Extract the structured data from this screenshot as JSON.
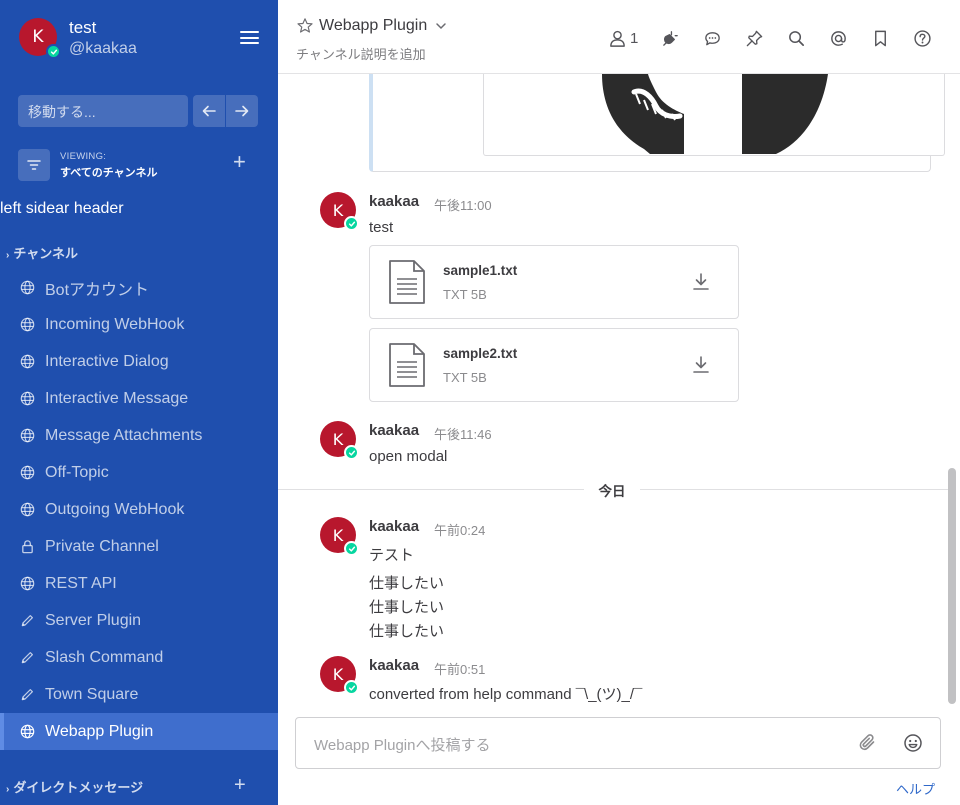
{
  "team": {
    "name": "test",
    "username": "@kaakaa",
    "avatar_letter": "K"
  },
  "jump": {
    "placeholder": "移動する..."
  },
  "viewing": {
    "label": "VIEWING:",
    "value": "すべてのチャンネル"
  },
  "sidebar_header": "left sidear header",
  "channels_category": "チャンネル",
  "channels": [
    {
      "name": "Botアカウント",
      "icon": "globe-icon"
    },
    {
      "name": "Incoming WebHook",
      "icon": "globe-icon"
    },
    {
      "name": "Interactive Dialog",
      "icon": "globe-icon"
    },
    {
      "name": "Interactive Message",
      "icon": "globe-icon"
    },
    {
      "name": "Message Attachments",
      "icon": "globe-icon"
    },
    {
      "name": "Off-Topic",
      "icon": "globe-icon"
    },
    {
      "name": "Outgoing WebHook",
      "icon": "globe-icon"
    },
    {
      "name": "Private Channel",
      "icon": "lock-icon"
    },
    {
      "name": "REST API",
      "icon": "globe-icon"
    },
    {
      "name": "Server Plugin",
      "icon": "pencil-icon"
    },
    {
      "name": "Slash Command",
      "icon": "pencil-icon"
    },
    {
      "name": "Town Square",
      "icon": "pencil-icon"
    },
    {
      "name": "Webapp Plugin",
      "icon": "globe-icon",
      "active": true
    }
  ],
  "dm_category": "ダイレクトメッセージ",
  "header": {
    "channel_name": "Webapp Plugin",
    "purpose": "チャンネル説明を追加",
    "member_count": "1"
  },
  "posts": [
    {
      "user": "kaakaa",
      "time": "午後11:00",
      "lines": [
        "test"
      ]
    },
    {
      "user": "kaakaa",
      "time": "午後11:46",
      "lines": [
        "open modal"
      ]
    },
    {
      "user": "kaakaa",
      "time": "午前0:24",
      "lines": [
        "テスト",
        "仕事したい",
        "仕事したい",
        "仕事したい"
      ]
    },
    {
      "user": "kaakaa",
      "time": "午前0:51",
      "lines": [
        "converted from help command ¯\\_(ツ)_/¯"
      ]
    }
  ],
  "files": [
    {
      "name": "sample1.txt",
      "meta": "TXT 5B"
    },
    {
      "name": "sample2.txt",
      "meta": "TXT 5B"
    }
  ],
  "date_separator": "今日",
  "composer": {
    "placeholder": "Webapp Pluginへ投稿する"
  },
  "help_link": "ヘルプ",
  "colors": {
    "sidebar": "#1f4fae",
    "active_channel": "#3f6ecd",
    "avatar": "#b8172d",
    "online": "#06d6a0",
    "link": "#2f68c9"
  }
}
